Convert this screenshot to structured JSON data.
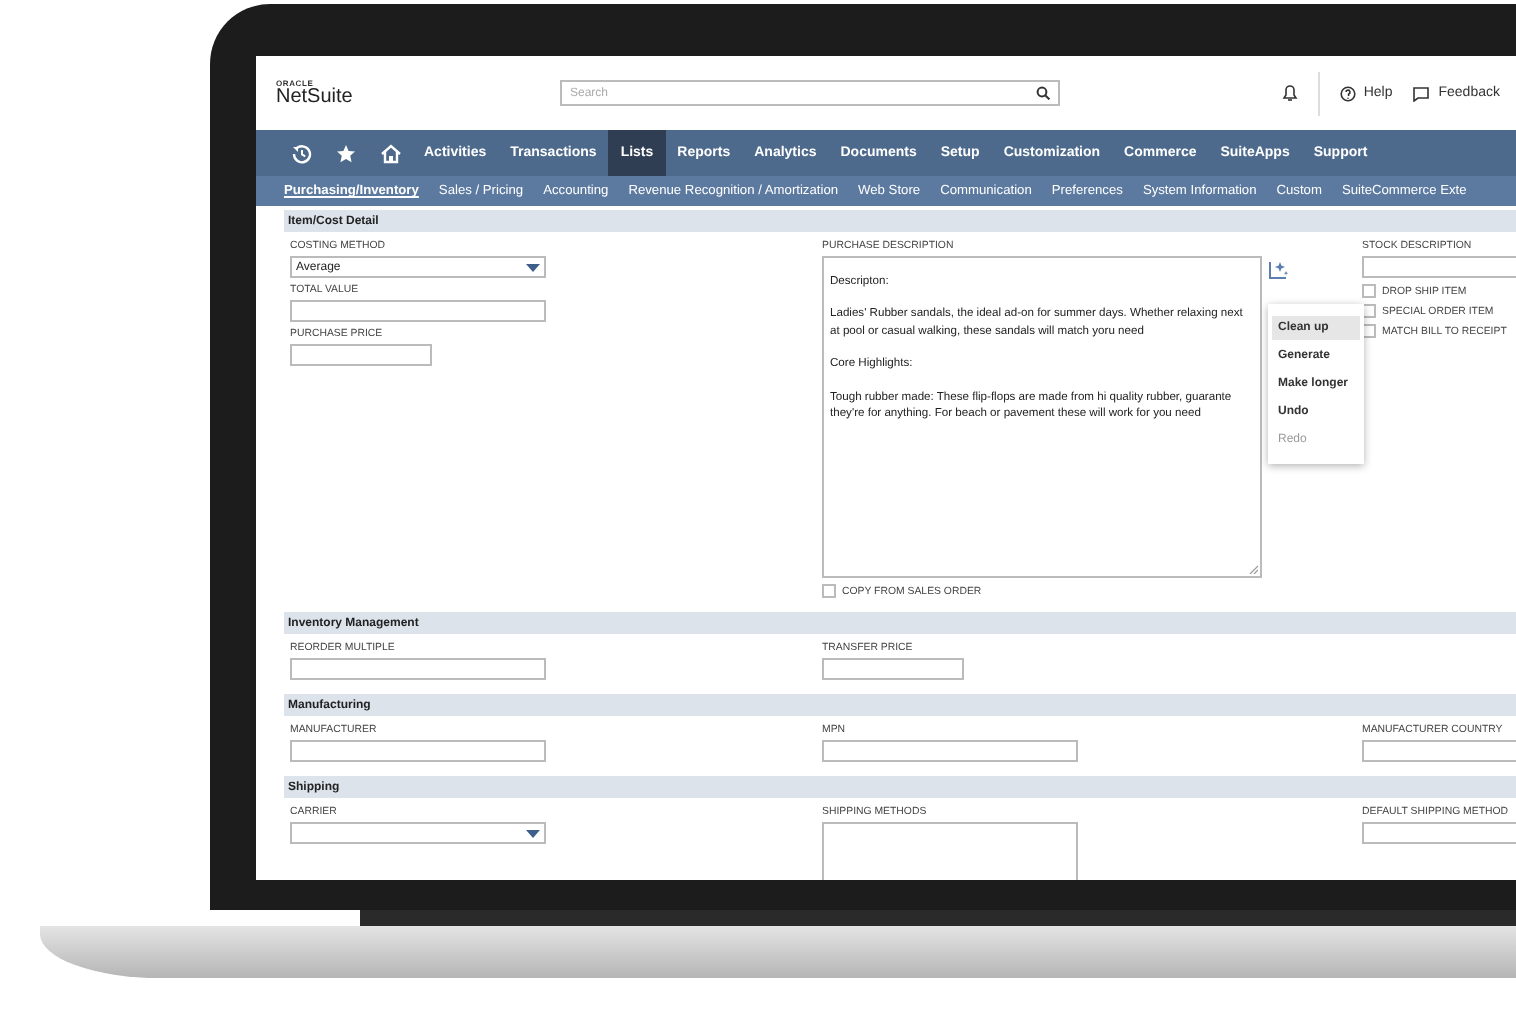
{
  "header": {
    "brand_caption": "ORACLE",
    "brand": "NetSuite",
    "search": {
      "placeholder": "Search"
    },
    "links": [
      {
        "label": "Help"
      },
      {
        "label": "Feedback"
      }
    ]
  },
  "nav": [
    {
      "label": "Activities",
      "selected": false
    },
    {
      "label": "Transactions",
      "selected": false
    },
    {
      "label": "Lists",
      "selected": true
    },
    {
      "label": "Reports",
      "selected": false
    },
    {
      "label": "Analytics",
      "selected": false
    },
    {
      "label": "Documents",
      "selected": false
    },
    {
      "label": "Setup",
      "selected": false
    },
    {
      "label": "Customization",
      "selected": false
    },
    {
      "label": "Commerce",
      "selected": false
    },
    {
      "label": "SuiteApps",
      "selected": false
    },
    {
      "label": "Support",
      "selected": false
    }
  ],
  "subtabs": [
    {
      "label": "Purchasing/Inventory",
      "selected": true
    },
    {
      "label": "Sales / Pricing",
      "selected": false
    },
    {
      "label": "Accounting",
      "selected": false
    },
    {
      "label": "Revenue Recognition / Amortization",
      "selected": false
    },
    {
      "label": "Web Store",
      "selected": false
    },
    {
      "label": "Communication",
      "selected": false
    },
    {
      "label": "Preferences",
      "selected": false
    },
    {
      "label": "System Information",
      "selected": false
    },
    {
      "label": "Custom",
      "selected": false
    },
    {
      "label": "SuiteCommerce Exte",
      "selected": false
    }
  ],
  "sections": [
    {
      "title": "Item/Cost Detail",
      "columns": [
        [
          {
            "kind": "select",
            "label": "COSTING METHOD",
            "value": "Average"
          },
          {
            "kind": "text",
            "label": "TOTAL VALUE"
          },
          {
            "kind": "short",
            "label": "PURCHASE PRICE"
          }
        ],
        [
          {
            "kind": "ai-textarea",
            "label": "PURCHASE DESCRIPTION",
            "paragraphs": [
              "Descripton:",
              "Ladies' Rubber sandals, the ideal ad-on for summer days. Whether relaxing next at pool or casual walking, these sandals will match yoru need",
              "Core Highlights:",
              "Tough rubber made: These flip-flops are made from hi quality rubber, guarante they're for anything. For beach or pavement these will work for you need"
            ],
            "menu": [
              {
                "label": "Clean up",
                "selected": true,
                "disabled": false
              },
              {
                "label": "Generate",
                "selected": false,
                "disabled": false
              },
              {
                "label": "Make longer",
                "selected": false,
                "disabled": false
              },
              {
                "label": "Undo",
                "selected": false,
                "disabled": false
              },
              {
                "label": "Redo",
                "selected": false,
                "disabled": true
              }
            ]
          },
          {
            "kind": "checkbox",
            "label": "COPY FROM SALES ORDER",
            "checked": false
          }
        ],
        [
          {
            "kind": "text",
            "label": "STOCK DESCRIPTION"
          },
          {
            "kind": "checkbox",
            "label": "DROP SHIP ITEM",
            "checked": false
          },
          {
            "kind": "checkbox",
            "label": "SPECIAL ORDER ITEM",
            "checked": false
          },
          {
            "kind": "checkbox",
            "label": "MATCH BILL TO RECEIPT",
            "checked": false
          }
        ]
      ]
    },
    {
      "title": "Inventory Management",
      "columns": [
        [
          {
            "kind": "text",
            "label": "REORDER MULTIPLE"
          }
        ],
        [
          {
            "kind": "short",
            "label": "TRANSFER PRICE"
          }
        ]
      ]
    },
    {
      "title": "Manufacturing",
      "columns": [
        [
          {
            "kind": "text",
            "label": "MANUFACTURER"
          }
        ],
        [
          {
            "kind": "text",
            "label": "MPN"
          }
        ],
        [
          {
            "kind": "text",
            "label": "MANUFACTURER COUNTRY"
          }
        ]
      ]
    },
    {
      "title": "Shipping",
      "columns": [
        [
          {
            "kind": "select",
            "label": "CARRIER"
          }
        ],
        [
          {
            "kind": "list",
            "label": "SHIPPING METHODS"
          }
        ],
        [
          {
            "kind": "text",
            "label": "DEFAULT SHIPPING METHOD"
          }
        ]
      ]
    }
  ]
}
